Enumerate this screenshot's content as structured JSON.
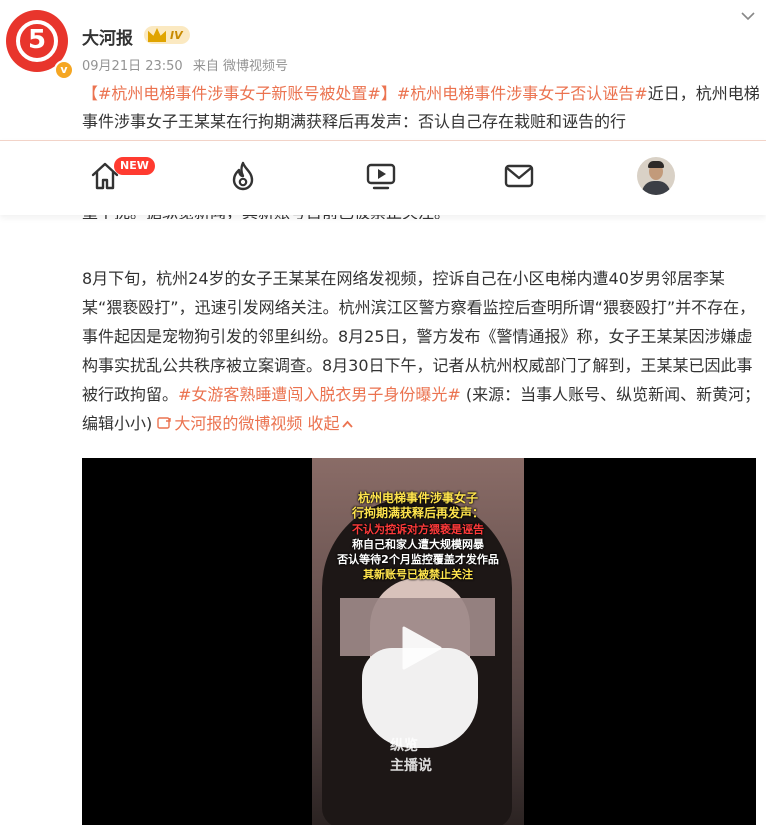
{
  "user": {
    "name": "大河报",
    "level": "IV",
    "avatar_char": "5",
    "verified": "v"
  },
  "meta": {
    "time": "09月21日 23:50",
    "source": "来自 微博视频号"
  },
  "post": {
    "bracket_open": "【",
    "topic1": "#杭州电梯事件涉事女子新账号被处置#",
    "bracket_close": "】",
    "topic2": "#杭州电梯事件涉事女子否认诬告#",
    "lead": "近日，杭州电梯事件涉事女子王某某在行拘期满获释后再发声：否认自己存在栽赃和诬告的行",
    "cut_line": "重干扰。据纵览新闻，其新账号目前已被禁止关注。",
    "para": "8月下旬，杭州24岁的女子王某某在网络发视频，控诉自己在小区电梯内遭40岁男邻居李某某“猥亵殴打”，迅速引发网络关注。杭州滨江区警方察看监控后查明所谓“猥亵殴打”并不存在，事件起因是宠物狗引发的邻里纠纷。8月25日，警方发布《警情通报》称，女子王某某因涉嫌虚构事实扰乱公共秩序被立案调查。8月30日下午，记者从杭州权威部门了解到，王某某已因此事被行政拘留。",
    "topic3": "#女游客熟睡遭闯入脱衣男子身份曝光#",
    "tail": " (来源：当事人账号、纵览新闻、新黄河；编辑小小) ",
    "video_link": "大河报的微博视频",
    "collapse": "收起"
  },
  "nav": {
    "home": "home",
    "new_badge": "NEW",
    "hot": "hot",
    "video": "video",
    "mail": "mail"
  },
  "video": {
    "cap1": "杭州电梯事件涉事女子",
    "cap2": "行拘期满获释后再发声：",
    "cap3": "不认为控诉对方猥亵是诬告",
    "cap4": "称自己和家人遭大规模网暴",
    "cap5": "否认等待2个月监控覆盖才发作品",
    "cap6": "其新账号已被禁止关注",
    "watermark1": "纵览",
    "watermark2": "主播说"
  }
}
